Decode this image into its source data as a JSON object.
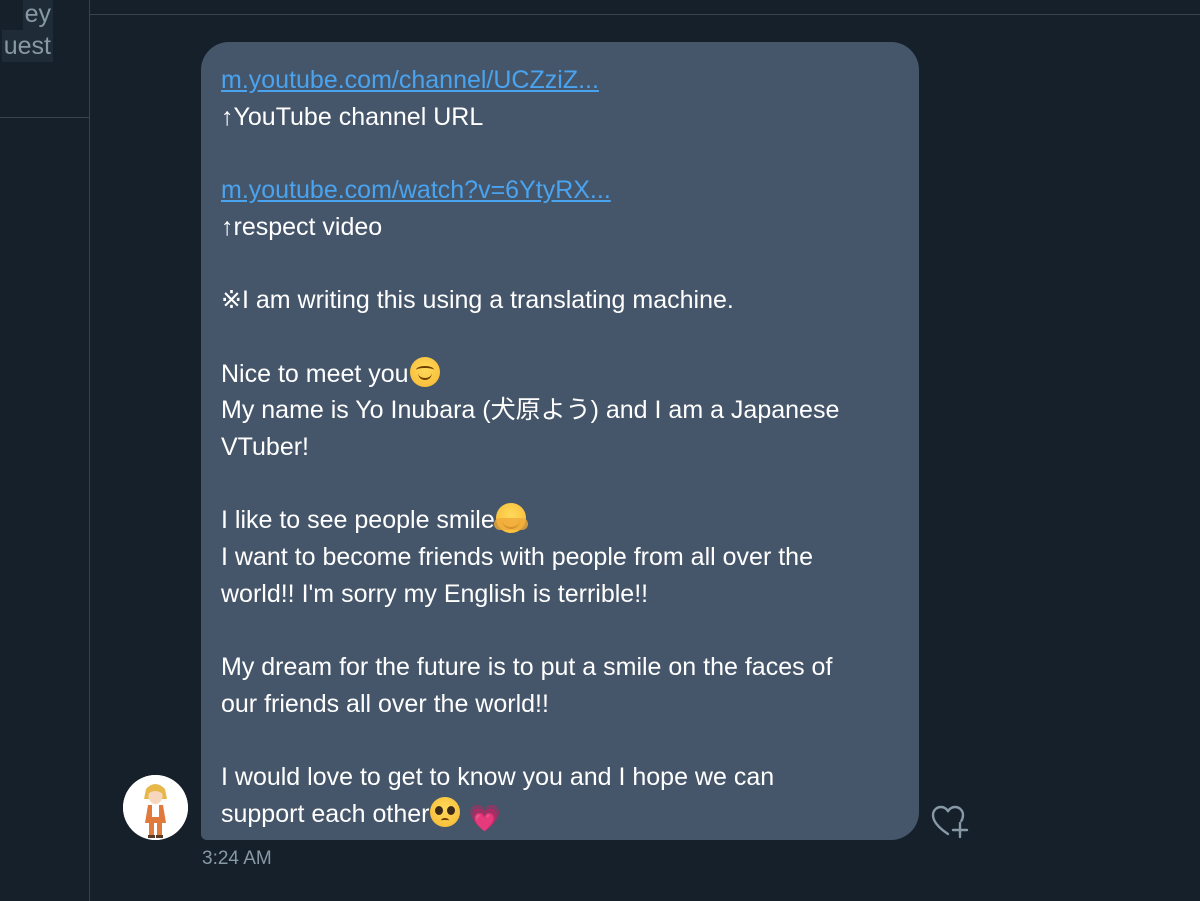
{
  "sidebar": {
    "conversation_preview_line1": "ey",
    "conversation_preview_line2": "uest"
  },
  "message": {
    "channel_link": "m.youtube.com/channel/UCZziZ...",
    "channel_caption": "↑YouTube channel URL",
    "video_link": "m.youtube.com/watch?v=6YtyRX...",
    "video_caption": "↑respect video",
    "note": "※I am writing this using a translating machine.",
    "greeting": "Nice to meet you",
    "intro_line1": "My name is Yo Inubara (犬原よう) and I am a Japanese",
    "intro_line2": "VTuber!",
    "smile_line": "I like to see people smile",
    "friends_line1": "I want to become friends with people from all over the",
    "friends_line2": "world!! I'm sorry my English is terrible!!",
    "dream_line1": "My dream for the future is to put a smile on the faces of",
    "dream_line2": "our friends all over the world!!",
    "closing_line1": "I would love to get to know you and I hope we can",
    "closing_line2": "support each other",
    "emojis": {
      "greeting": "smiling-face-emoji",
      "smile_line": "hugging-face-emoji",
      "closing": [
        "pleading-face-emoji",
        "growing-heart-emoji"
      ]
    },
    "timestamp": "3:24 AM"
  },
  "icons": {
    "react": "heart-plus-icon",
    "avatar": "anime-character-avatar"
  },
  "colors": {
    "background": "#15202b",
    "bubble": "#46566a",
    "link": "#4aa3ef",
    "text": "#ffffff",
    "muted": "#8899a6"
  }
}
